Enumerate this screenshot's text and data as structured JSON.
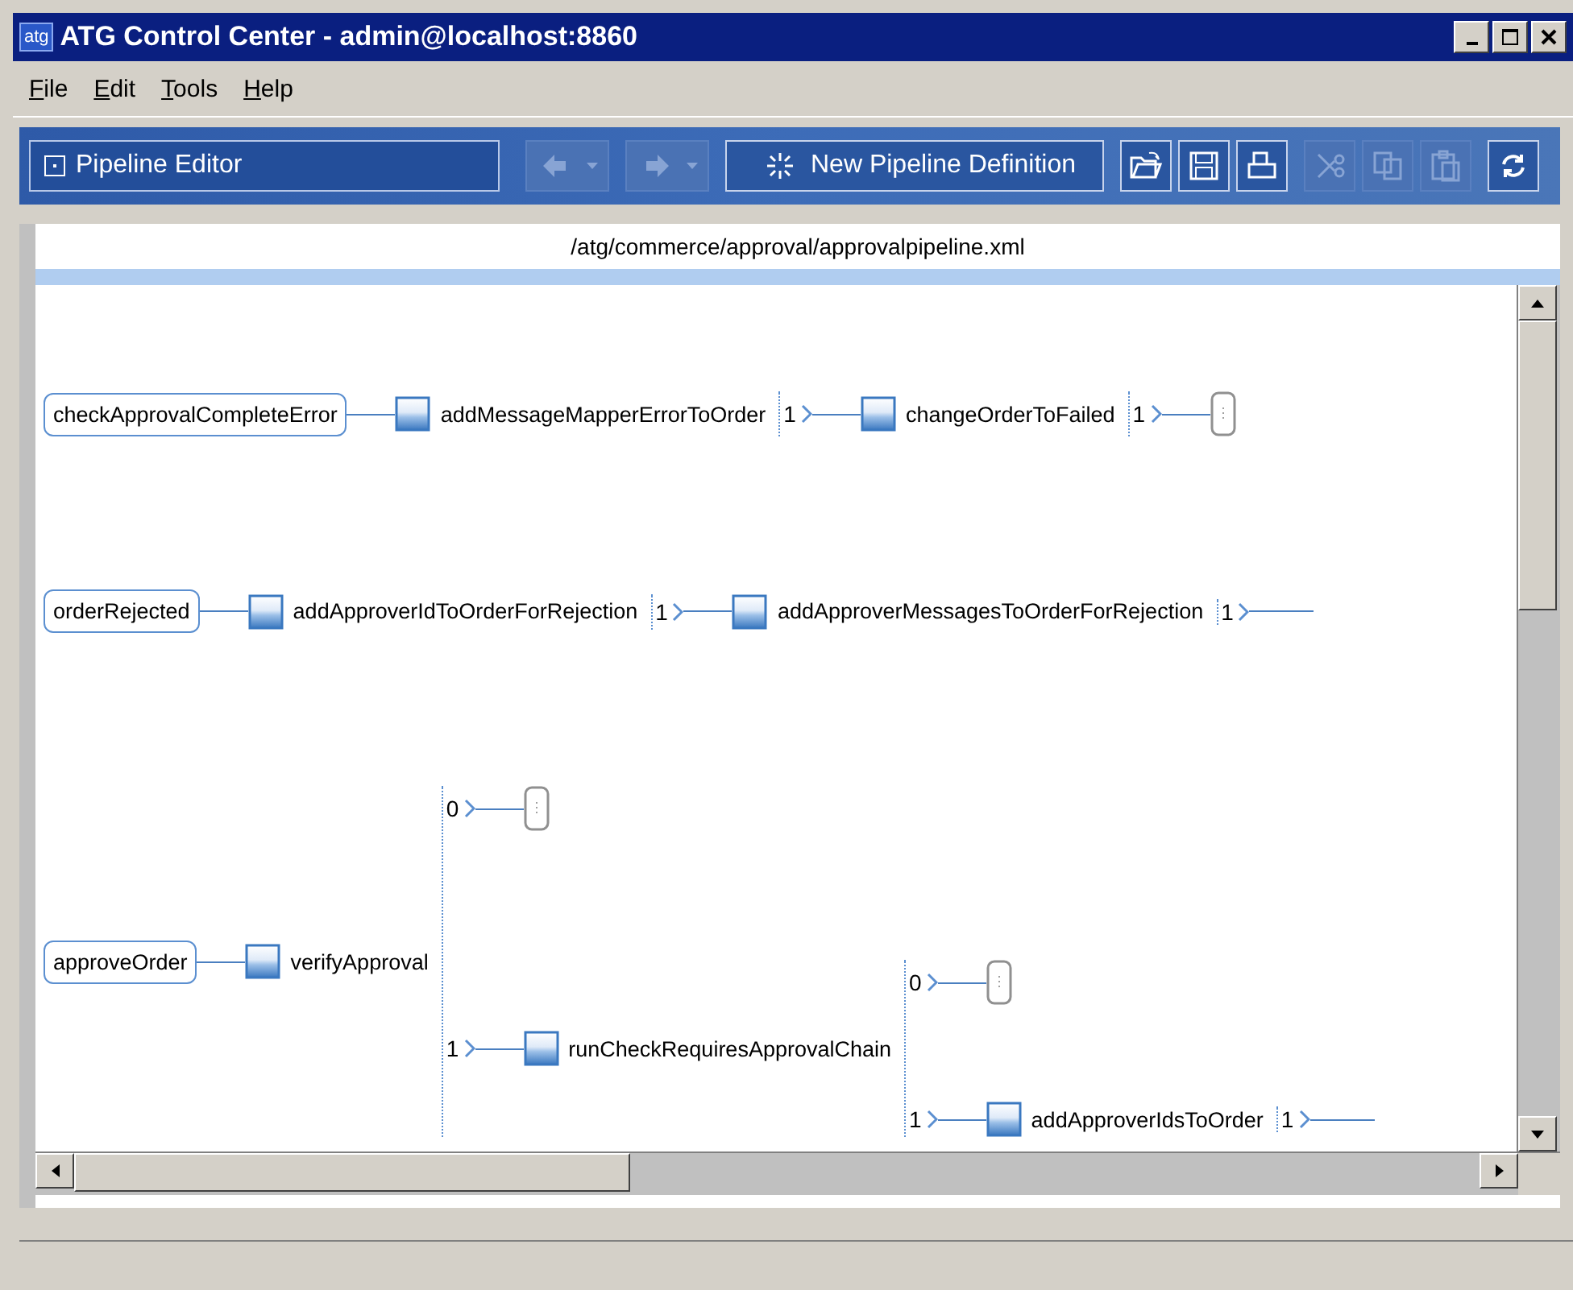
{
  "window": {
    "logo": "atg",
    "title": "ATG Control Center - admin@localhost:8860"
  },
  "menu": [
    {
      "label": "File"
    },
    {
      "label": "Edit"
    },
    {
      "label": "Tools"
    },
    {
      "label": "Help"
    }
  ],
  "toolbar": {
    "editor_selector": {
      "label": "Pipeline Editor"
    },
    "groups": [
      {
        "buttons": [
          {
            "kind": "back",
            "disabled": true
          }
        ]
      },
      {
        "buttons": [
          {
            "kind": "forward",
            "disabled": true
          }
        ]
      },
      {
        "buttons": [
          {
            "kind": "new",
            "label": "New Pipeline Definition",
            "disabled": false
          }
        ]
      },
      {
        "buttons": [
          {
            "kind": "open",
            "disabled": false
          },
          {
            "kind": "save",
            "disabled": false
          },
          {
            "kind": "print",
            "disabled": false
          }
        ]
      },
      {
        "buttons": [
          {
            "kind": "cut",
            "disabled": true
          },
          {
            "kind": "copy",
            "disabled": true
          },
          {
            "kind": "paste",
            "disabled": true
          }
        ]
      },
      {
        "buttons": [
          {
            "kind": "refresh",
            "disabled": false
          }
        ]
      }
    ]
  },
  "file_path": "/atg/commerce/approval/approvalpipeline.xml",
  "chains": [
    {
      "kind": "start",
      "name": "checkApprovalCompleteError",
      "next": {
        "kind": "processor",
        "name": "addMessageMapperErrorToOrder",
        "outputs": [
          {
            "port": "1",
            "next": {
              "kind": "processor",
              "name": "changeOrderToFailed",
              "outputs": [
                {
                  "port": "1",
                  "next": {
                    "kind": "end"
                  }
                }
              ]
            }
          }
        ]
      }
    },
    {
      "kind": "start",
      "name": "orderRejected",
      "next": {
        "kind": "processor",
        "name": "addApproverIdToOrderForRejection",
        "outputs": [
          {
            "port": "1",
            "next": {
              "kind": "processor",
              "name": "addApproverMessagesToOrderForRejection",
              "outputs": [
                {
                  "port": "1"
                }
              ]
            }
          }
        ]
      }
    },
    {
      "kind": "start",
      "name": "approveOrder",
      "next": {
        "kind": "processor",
        "name": "verifyApproval",
        "outputs": [
          {
            "port": "0",
            "next": {
              "kind": "end"
            }
          },
          {
            "port": "1",
            "next": {
              "kind": "processor",
              "name": "runCheckRequiresApprovalChain",
              "outputs": [
                {
                  "port": "0",
                  "next": {
                    "kind": "end"
                  }
                },
                {
                  "port": "1",
                  "next": {
                    "kind": "processor",
                    "name": "addApproverIdsToOrder",
                    "outputs": [
                      {
                        "port": "1"
                      }
                    ]
                  }
                }
              ]
            }
          }
        ]
      }
    }
  ]
}
